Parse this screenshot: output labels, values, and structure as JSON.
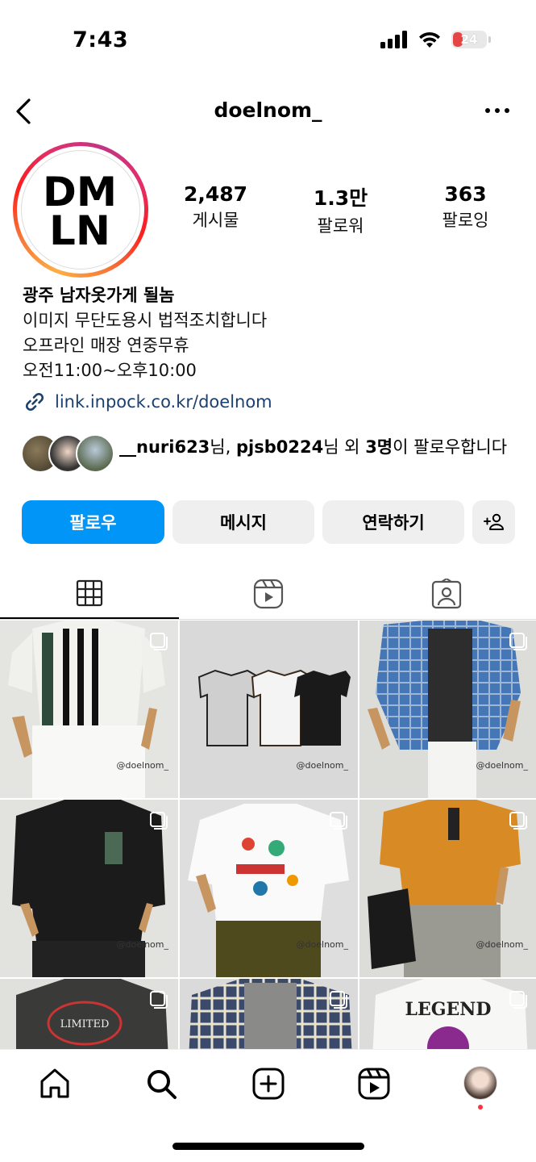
{
  "status_bar": {
    "time": "7:43",
    "battery": "24"
  },
  "header": {
    "username": "doelnom_"
  },
  "profile": {
    "avatar_logo": "DMLN",
    "stats": [
      {
        "value": "2,487",
        "label": "게시물"
      },
      {
        "value": "1.3만",
        "label": "팔로워"
      },
      {
        "value": "363",
        "label": "팔로잉"
      }
    ],
    "bio": {
      "name": "광주 남자옷가게 될놈",
      "lines": [
        "이미지 무단도용시 법적조치합니다",
        "오프라인 매장 연중무휴",
        "오전11:00~오후10:00"
      ],
      "link": "link.inpock.co.kr/doelnom"
    },
    "followed_by": {
      "user1": "__nuri623",
      "mid1": "님, ",
      "user2": "pjsb0224",
      "mid2": "님 외 ",
      "count": "3명",
      "suffix": "이 팔로우합니다"
    }
  },
  "actions": {
    "follow": "팔로우",
    "message": "메시지",
    "contact": "연락하기"
  },
  "tabs": [
    "grid-icon",
    "reels-icon",
    "tagged-icon"
  ],
  "grid": {
    "watermark": "@doelnom_",
    "posts": [
      {
        "watermark": "@doelnom_"
      },
      {
        "watermark": "@doelnom_"
      },
      {
        "watermark": "@doelnom_"
      },
      {
        "watermark": "@doelnom_"
      },
      {
        "watermark": "@doelnom_"
      },
      {
        "watermark": "@doelnom_"
      },
      {
        "watermark": ""
      },
      {
        "watermark": ""
      },
      {
        "watermark": ""
      }
    ],
    "post_texts": {
      "limited": "LIMITED",
      "legend": "LEGEND"
    }
  },
  "colors": {
    "accent": "#0095f6",
    "link": "#1c3f6e"
  }
}
